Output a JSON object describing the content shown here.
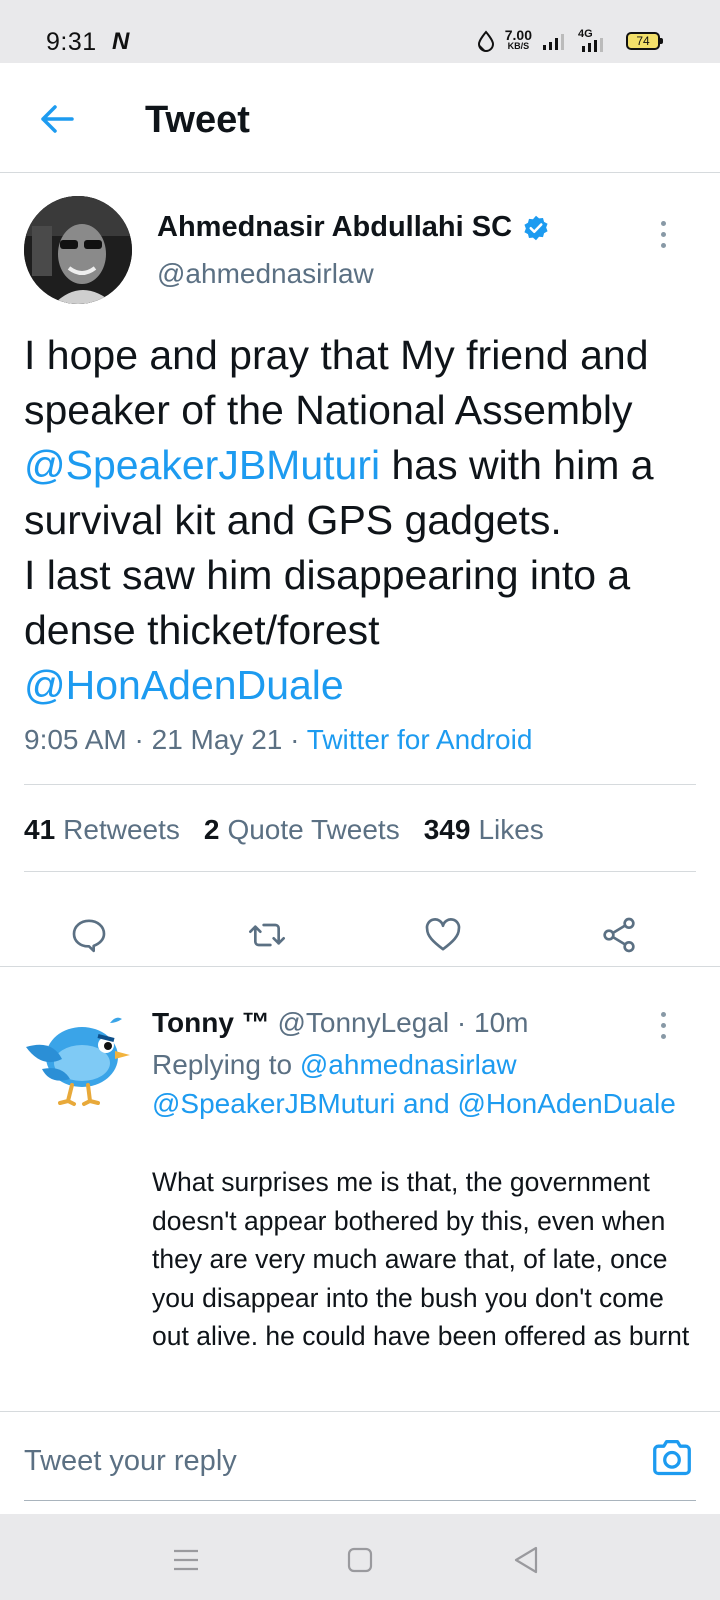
{
  "status_bar": {
    "time": "9:31",
    "carrier_icon": "N",
    "net_speed_value": "7.00",
    "net_speed_unit": "KB/S",
    "network_type": "4G",
    "battery": "74"
  },
  "header": {
    "back_icon": "arrow-left-icon",
    "title": "Tweet"
  },
  "tweet": {
    "author_name": "Ahmednasir Abdullahi SC",
    "author_handle": "@ahmednasirlaw",
    "verified": true,
    "text_segments": [
      {
        "text": "I hope and pray that My friend and speaker of the National Assembly ",
        "mention": false
      },
      {
        "text": "@SpeakerJBMuturi",
        "mention": true
      },
      {
        "text": " has with him a survival kit and GPS gadgets.\nI last saw him disappearing into a dense thicket/forest\n",
        "mention": false
      },
      {
        "text": "@HonAdenDuale",
        "mention": true
      }
    ],
    "time": "9:05 AM",
    "date": "21 May 21",
    "source": "Twitter for Android",
    "stats": {
      "retweets_count": "41",
      "retweets_label": "Retweets",
      "quote_count": "2",
      "quote_label": "Quote Tweets",
      "likes_count": "349",
      "likes_label": "Likes"
    },
    "actions": [
      "reply-icon",
      "retweet-icon",
      "like-icon",
      "share-icon"
    ]
  },
  "reply": {
    "name": "Tonny ™",
    "handle": "@TonnyLegal",
    "time": "10m",
    "replying_label": "Replying to",
    "replying_to": "@ahmednasirlaw @SpeakerJBMuturi and @HonAdenDuale",
    "text": "What surprises me is that, the government doesn't appear bothered by this, even when they are very much aware that, of late, once you disappear into the bush you don't come out alive. he  could have been offered as burnt"
  },
  "composer": {
    "placeholder": "Tweet your reply",
    "camera_icon": "camera-icon"
  },
  "colors": {
    "accent": "#1d9bf0",
    "secondary_text": "#5b7083",
    "primary_text": "#0f1419",
    "system_bar": "#e9e9eb"
  }
}
